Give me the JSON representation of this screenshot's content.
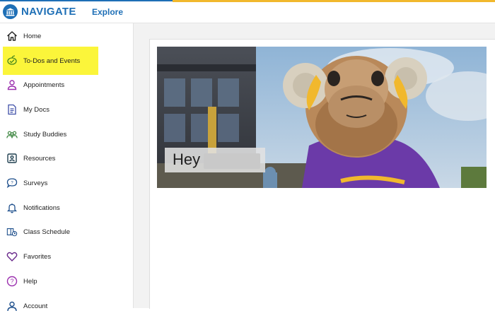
{
  "header": {
    "logo_text": "NAVIGATE",
    "nav_link": "Explore",
    "colors": {
      "brand_blue": "#1e6fb6",
      "accent_gold": "#f1b82d"
    }
  },
  "sidebar": {
    "items": [
      {
        "label": "Home",
        "icon": "home-icon"
      },
      {
        "label": "To-Dos and Events",
        "icon": "todo-events-icon",
        "active": true
      },
      {
        "label": "Appointments",
        "icon": "person-icon"
      },
      {
        "label": "My Docs",
        "icon": "document-icon"
      },
      {
        "label": "Study Buddies",
        "icon": "people-icon"
      },
      {
        "label": "Resources",
        "icon": "resources-icon"
      },
      {
        "label": "Surveys",
        "icon": "chat-bubble-icon"
      },
      {
        "label": "Notifications",
        "icon": "bell-icon"
      },
      {
        "label": "Class Schedule",
        "icon": "class-schedule-icon"
      },
      {
        "label": "Favorites",
        "icon": "heart-icon"
      },
      {
        "label": "Help",
        "icon": "question-icon"
      },
      {
        "label": "Account",
        "icon": "account-icon"
      }
    ],
    "highlight_color": "#fbf53a"
  },
  "main": {
    "banner": {
      "greeting": "Hey"
    }
  }
}
